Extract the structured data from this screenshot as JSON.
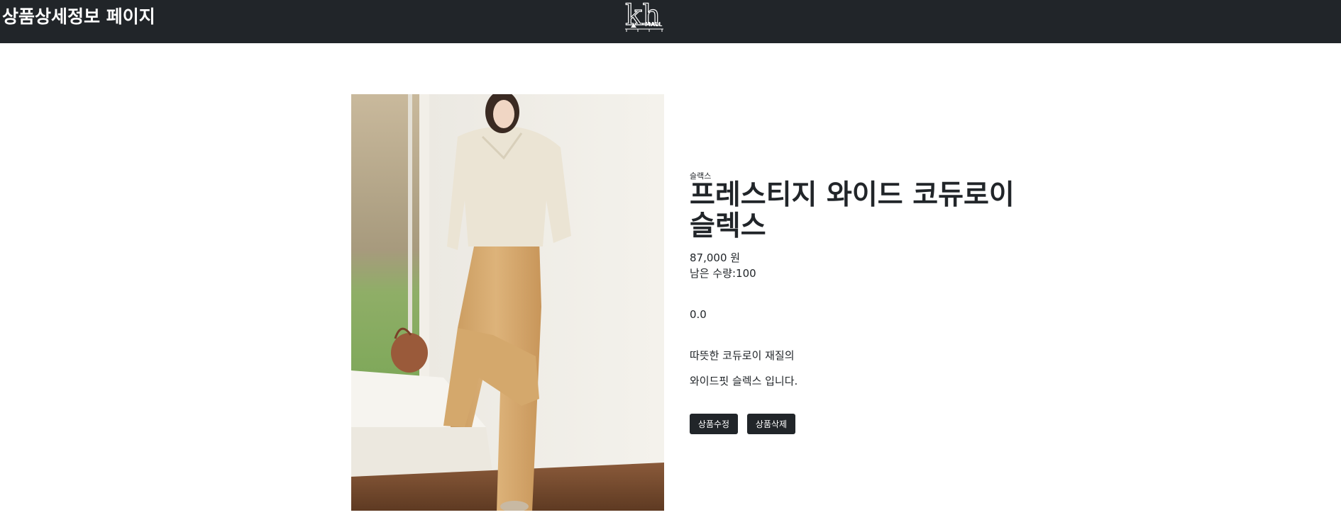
{
  "header": {
    "title": "상품상세정보 페이지",
    "logo_text": "kh",
    "logo_sub": "MALL"
  },
  "product": {
    "category": "슬랙스",
    "name": "프레스티지 와이드 코듀로이 슬렉스",
    "price": "87,000 원",
    "stock": "남은 수량:100",
    "rating": "0.0",
    "description_line1": "따뜻한 코듀로이 재질의",
    "description_line2": "와이드핏 슬렉스 입니다."
  },
  "actions": {
    "edit_label": "상품수정",
    "delete_label": "상품삭제"
  },
  "colors": {
    "dark": "#212529",
    "white": "#ffffff"
  }
}
